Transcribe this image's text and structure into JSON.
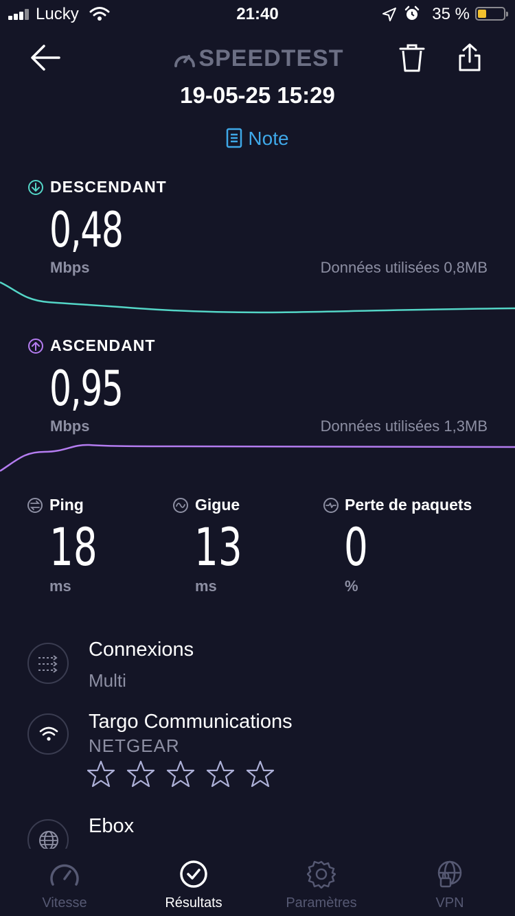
{
  "status_bar": {
    "carrier": "Lucky",
    "time": "21:40",
    "battery": "35 %"
  },
  "header": {
    "brand": "SPEEDTEST",
    "datetime": "19-05-25 15:29",
    "note_label": "Note"
  },
  "download": {
    "label": "DESCENDANT",
    "value": "0,48",
    "unit": "Mbps",
    "data_used": "Données utilisées 0,8MB",
    "color": "#54d6c7"
  },
  "upload": {
    "label": "ASCENDANT",
    "value": "0,95",
    "unit": "Mbps",
    "data_used": "Données utilisées 1,3MB",
    "color": "#b47cf0"
  },
  "metrics": {
    "ping": {
      "label": "Ping",
      "value": "18",
      "unit": "ms"
    },
    "jitter": {
      "label": "Gigue",
      "value": "13",
      "unit": "ms"
    },
    "loss": {
      "label": "Perte de paquets",
      "value": "0",
      "unit": "%"
    }
  },
  "details": {
    "connections": {
      "title": "Connexions",
      "value": "Multi",
      "icon": "connections-icon"
    },
    "network": {
      "title": "Targo Communications",
      "value": "NETGEAR",
      "icon": "wifi-icon",
      "rating": 0,
      "stars": 5
    },
    "server": {
      "title": "Ebox",
      "icon": "globe-icon"
    }
  },
  "tabs": [
    {
      "label": "Vitesse",
      "icon": "speed-gauge-icon",
      "active": false
    },
    {
      "label": "Résultats",
      "icon": "results-check-icon",
      "active": true
    },
    {
      "label": "Paramètres",
      "icon": "settings-gear-icon",
      "active": false
    },
    {
      "label": "VPN",
      "icon": "vpn-globe-lock-icon",
      "active": false
    }
  ]
}
